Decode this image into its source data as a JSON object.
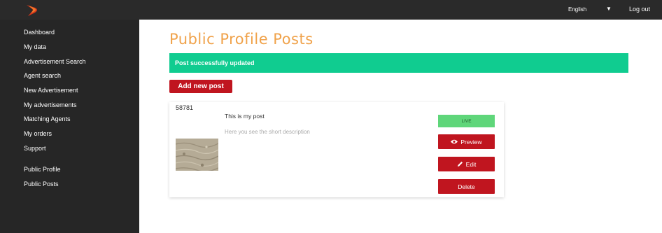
{
  "header": {
    "language": "English",
    "logout_label": "Log out",
    "logo_color": "#d9371b"
  },
  "sidebar": {
    "items": [
      {
        "label": "Dashboard"
      },
      {
        "label": "My data"
      },
      {
        "label": "Advertisement Search"
      },
      {
        "label": "Agent search"
      },
      {
        "label": "New Advertisement"
      },
      {
        "label": "My advertisements"
      },
      {
        "label": "Matching Agents"
      },
      {
        "label": "My orders"
      },
      {
        "label": "Support"
      },
      {
        "label": "Public Profile"
      },
      {
        "label": "Public Posts"
      }
    ]
  },
  "main": {
    "title": "Public Profile Posts",
    "alert": "Post successfully updated",
    "add_button": "Add new post",
    "post": {
      "id": "58781",
      "title": "This is my post",
      "description": "Here you see the short description",
      "status": "LIVE",
      "preview_label": "Preview",
      "edit_label": "Edit",
      "delete_label": "Delete"
    }
  },
  "colors": {
    "accent": "#c0151f",
    "title": "#f0a24a",
    "success": "#10cc90",
    "live": "#5fd67a"
  }
}
